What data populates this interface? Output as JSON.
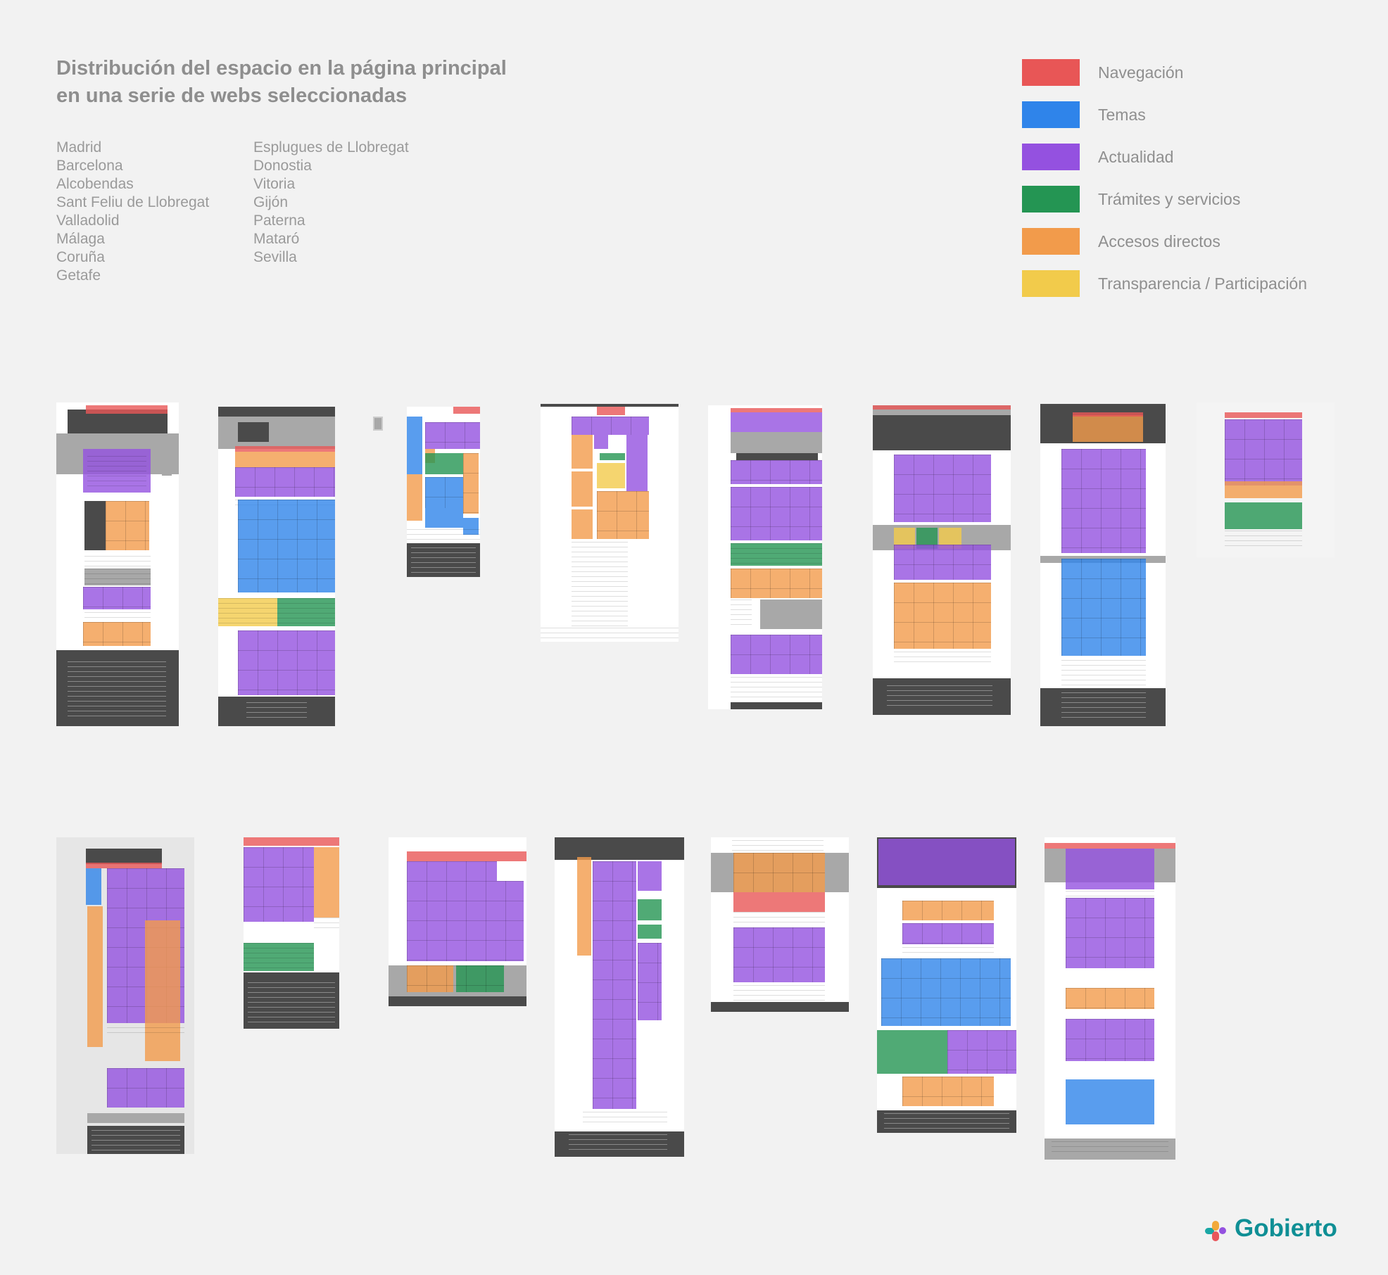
{
  "title": {
    "line1": "Distribución del espacio en la página principal",
    "line2": "en una serie de webs seleccionadas"
  },
  "cities_col1": [
    "Madrid",
    "Barcelona",
    "Alcobendas",
    "Sant Feliu de Llobregat",
    "Valladolid",
    "Málaga",
    "Coruña",
    "Getafe"
  ],
  "cities_col2": [
    "Esplugues de Llobregat",
    "Donostia",
    "Vitoria",
    "Gijón",
    "Paterna",
    "Mataró",
    "Sevilla"
  ],
  "legend": [
    {
      "label": "Navegación",
      "color": "#e85656"
    },
    {
      "label": "Temas",
      "color": "#2f84ea"
    },
    {
      "label": "Actualidad",
      "color": "#9451e0"
    },
    {
      "label": "Trámites y servicios",
      "color": "#249553"
    },
    {
      "label": "Accesos directos",
      "color": "#f29b4b"
    },
    {
      "label": "Transparencia / Participación",
      "color": "#f2cb4b"
    }
  ],
  "logo": {
    "text": "Gobierto",
    "color": "#0f8f95"
  }
}
